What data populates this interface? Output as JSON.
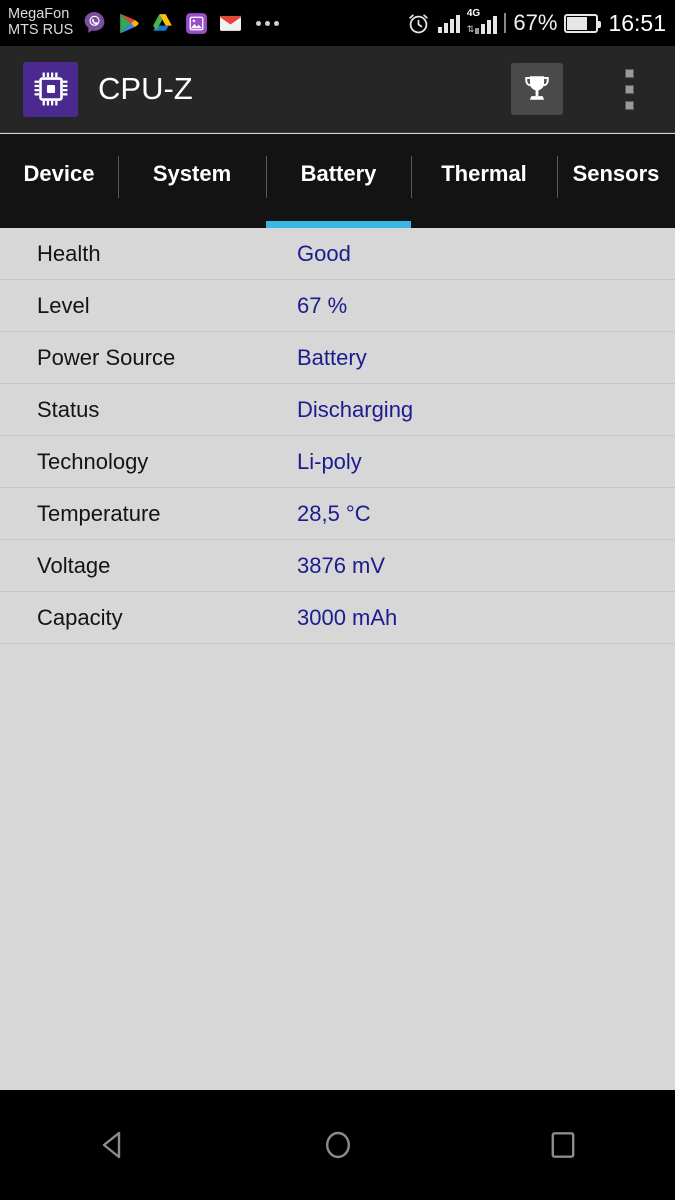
{
  "status_bar": {
    "carrier_line1": "MegaFon",
    "carrier_line2": "MTS RUS",
    "notification_icons": [
      "viber-icon",
      "google-play-icon",
      "google-drive-icon",
      "gallery-icon",
      "gmail-icon",
      "more-notifications-icon"
    ],
    "alarm_icon": "alarm-clock-icon",
    "network_label": "4G",
    "battery_percent": "67%",
    "time": "16:51"
  },
  "app_bar": {
    "app_icon": "cpu-chip-icon",
    "title": "CPU-Z",
    "trophy_icon": "trophy-icon",
    "overflow_icon": "overflow-menu-icon"
  },
  "tabs": [
    {
      "label": "Device",
      "active": false
    },
    {
      "label": "System",
      "active": false
    },
    {
      "label": "Battery",
      "active": true
    },
    {
      "label": "Thermal",
      "active": false
    },
    {
      "label": "Sensors",
      "active": false
    }
  ],
  "battery_info": {
    "rows": [
      {
        "key": "Health",
        "value": "Good"
      },
      {
        "key": "Level",
        "value": "67 %"
      },
      {
        "key": "Power Source",
        "value": "Battery"
      },
      {
        "key": "Status",
        "value": "Discharging"
      },
      {
        "key": "Technology",
        "value": "Li-poly"
      },
      {
        "key": "Temperature",
        "value": "28,5 °C"
      },
      {
        "key": "Voltage",
        "value": "3876 mV"
      },
      {
        "key": "Capacity",
        "value": "3000 mAh"
      }
    ]
  },
  "nav_bar": {
    "back": "back-icon",
    "home": "home-icon",
    "recents": "recents-icon"
  },
  "colors": {
    "accent_blue": "#39b6e4",
    "value_text": "#1c1c8e",
    "app_icon_purple": "#4a2a8e",
    "content_bg": "#d7d7d7",
    "appbar_bg": "#262626",
    "tabbar_bg": "#131313"
  }
}
